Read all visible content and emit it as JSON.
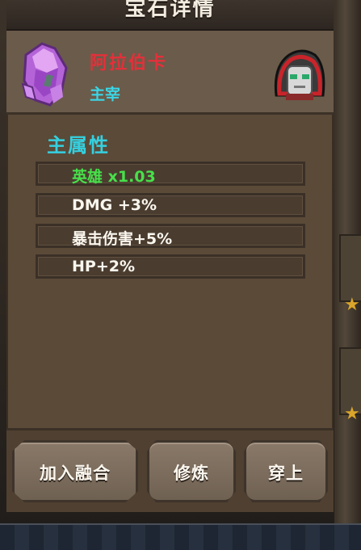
{
  "dialog": {
    "title": "宝石详情"
  },
  "gem": {
    "name": "阿拉伯卡",
    "owner_label": "主宰",
    "icon": "purple-crystal-icon",
    "hero_icon": "hooded-hero-avatar-icon"
  },
  "attributes": {
    "title": "主属性",
    "rows": [
      {
        "text": "英雄 x1.03",
        "highlighted": true
      },
      {
        "text": "DMG +3%",
        "highlighted": false
      },
      {
        "text": "暴击伤害+5%",
        "highlighted": false
      },
      {
        "text": "HP+2%",
        "highlighted": false
      }
    ]
  },
  "actions": {
    "fuse_label": "加入融合",
    "refine_label": "修炼",
    "equip_label": "穿上"
  },
  "colors": {
    "gem_name": "#e4303a",
    "owner": "#3ad6e6",
    "attr_title": "#35d0e0",
    "highlight_attr": "#47e04a",
    "panel": "#5b4a38"
  }
}
